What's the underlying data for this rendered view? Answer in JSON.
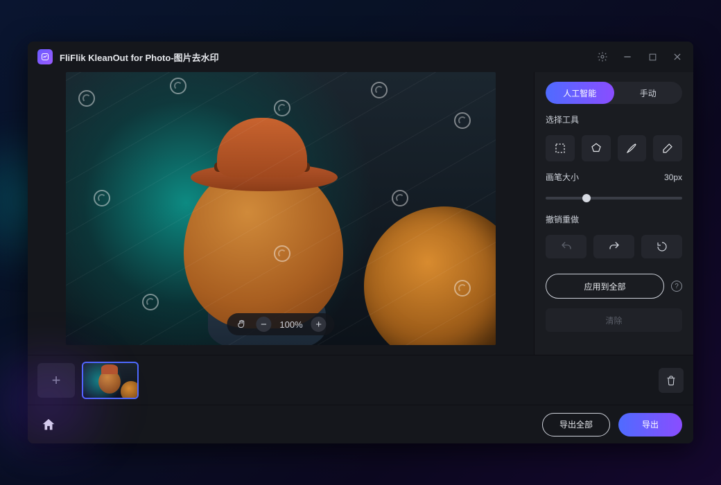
{
  "app": {
    "title": "FliFlik KleanOut for Photo-图片去水印"
  },
  "titlebar": {
    "settings_icon": "gear-icon",
    "minimize_icon": "minimize-icon",
    "maximize_icon": "maximize-icon",
    "close_icon": "close-icon"
  },
  "zoom": {
    "level": "100%",
    "hand_icon": "hand-icon",
    "minus_icon": "zoom-out-icon",
    "plus_icon": "zoom-in-icon"
  },
  "side": {
    "tabs": {
      "ai": "人工智能",
      "manual": "手动",
      "active": "ai"
    },
    "tools_label": "选择工具",
    "tools": {
      "marquee": "marquee-icon",
      "lasso": "lasso-icon",
      "brush": "brush-icon",
      "eraser": "eraser-icon"
    },
    "brush_label": "画笔大小",
    "brush_value": "30px",
    "undo_label": "撤销重做",
    "undo_icons": {
      "undo": "undo-icon",
      "redo": "redo-icon",
      "reset": "reset-icon"
    },
    "apply_all": "应用到全部",
    "info_icon": "info-icon",
    "clear": "清除"
  },
  "thumbs": {
    "add_icon": "plus-icon",
    "trash_icon": "trash-icon",
    "selected_index": 0
  },
  "footer": {
    "home_icon": "home-icon",
    "export_all": "导出全部",
    "export": "导出"
  },
  "colors": {
    "accent_from": "#4f6bff",
    "accent_to": "#8a4dff",
    "panel": "#1a1c21",
    "surface": "#24262d"
  }
}
